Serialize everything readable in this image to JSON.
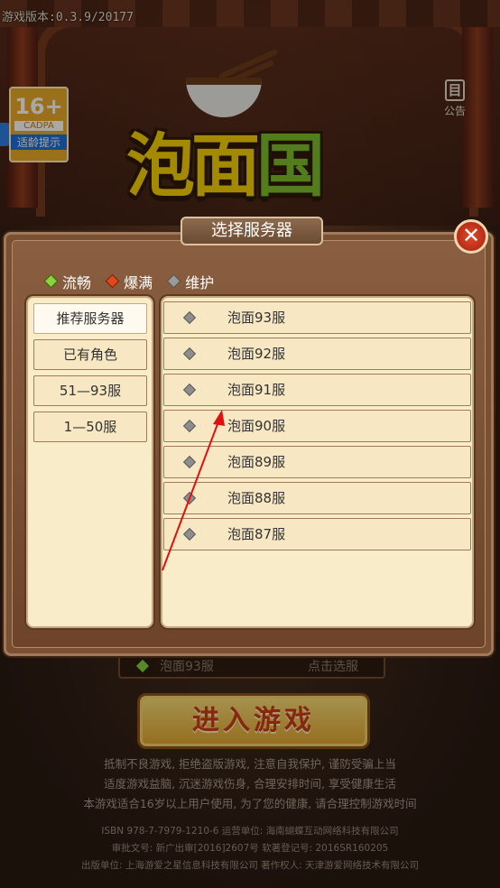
{
  "version_text": "游戏版本:0.3.9/20177",
  "age_badge": {
    "number": "16+",
    "org": "CADPA",
    "label": "适龄提示"
  },
  "notice": {
    "glyph": "目",
    "label": "公告"
  },
  "logo": {
    "part1": "泡面",
    "part2": "国"
  },
  "modal": {
    "title": "选择服务器",
    "close_glyph": "✕",
    "legend": [
      {
        "label": "流畅",
        "color": "#8ad33a"
      },
      {
        "label": "爆满",
        "color": "#e04a1a"
      },
      {
        "label": "维护",
        "color": "#9a9a9a"
      }
    ],
    "categories": [
      {
        "label": "推荐服务器",
        "active": true
      },
      {
        "label": "已有角色",
        "active": false
      },
      {
        "label": "51—93服",
        "active": false
      },
      {
        "label": "1—50服",
        "active": false
      }
    ],
    "servers": [
      {
        "name": "泡面93服",
        "status": "维护"
      },
      {
        "name": "泡面92服",
        "status": "维护"
      },
      {
        "name": "泡面91服",
        "status": "维护"
      },
      {
        "name": "泡面90服",
        "status": "维护"
      },
      {
        "name": "泡面89服",
        "status": "维护"
      },
      {
        "name": "泡面88服",
        "status": "维护"
      },
      {
        "name": "泡面87服",
        "status": "维护"
      }
    ]
  },
  "current_server": {
    "name": "泡面93服",
    "action": "点击选服"
  },
  "enter_button": "进入游戏",
  "health_notice": [
    "抵制不良游戏, 拒绝盗版游戏, 注意自我保护, 谨防受骗上当",
    "适度游戏益脑, 沉迷游戏伤身, 合理安排时间, 享受健康生活",
    "本游戏适合16岁以上用户使用, 为了您的健康, 请合理控制游戏时间"
  ],
  "footer": [
    "ISBN 978-7-7979-1210-6 运营单位: 海南蝴蝶互动网络科技有限公司",
    "审批文号: 新广出审[2016]2607号 软著登记号: 2016SR160205",
    "出版单位: 上海游爱之星信息科技有限公司 著作权人: 天津游爱网络技术有限公司"
  ],
  "annotation_color": "#e01010"
}
